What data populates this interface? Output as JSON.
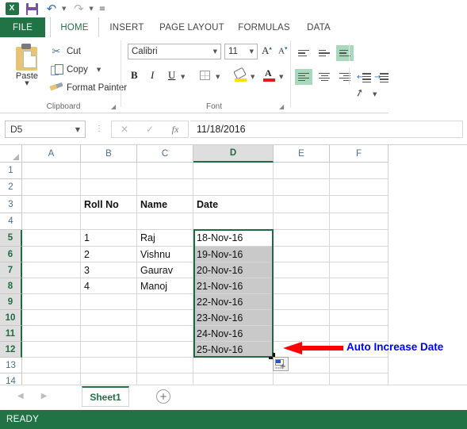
{
  "quick_access": {
    "app_icon": "excel-logo-icon",
    "items": [
      {
        "name": "save",
        "icon": "save-icon"
      },
      {
        "name": "undo",
        "icon": "undo-arrow-icon"
      },
      {
        "name": "redo",
        "icon": "redo-arrow-icon"
      },
      {
        "name": "customize",
        "icon": "customize-qat-icon"
      }
    ]
  },
  "ribbon": {
    "tabs": [
      {
        "label": "FILE",
        "active": false
      },
      {
        "label": "HOME",
        "active": true
      },
      {
        "label": "INSERT",
        "active": false
      },
      {
        "label": "PAGE LAYOUT",
        "active": false
      },
      {
        "label": "FORMULAS",
        "active": false
      },
      {
        "label": "DATA",
        "active": false
      }
    ],
    "clipboard": {
      "group_label": "Clipboard",
      "paste_label": "Paste",
      "cut_label": "Cut",
      "copy_label": "Copy",
      "format_painter_label": "Format Painter"
    },
    "font": {
      "group_label": "Font",
      "font_name": "Calibri",
      "font_size": "11",
      "bold_label": "B",
      "italic_label": "I",
      "underline_label": "U",
      "grow_font_label": "A",
      "shrink_font_label": "A",
      "fill_color": "#ffe000",
      "font_color": "#e01b1b"
    },
    "alignment": {
      "top_align": "top-align-icon",
      "middle_align": "middle-align-icon",
      "bottom_align": "bottom-align-icon",
      "orientation": "orientation-icon",
      "align_left": "align-left-icon",
      "align_center": "align-center-icon",
      "align_right": "align-right-icon",
      "decrease_indent": "decrease-indent-icon",
      "increase_indent": "increase-indent-icon"
    }
  },
  "formula_bar": {
    "name_box_value": "D5",
    "cancel_icon": "cancel-icon",
    "enter_icon": "enter-checkmark-icon",
    "function_icon": "fx",
    "formula_value": "11/18/2016"
  },
  "grid": {
    "columns": [
      {
        "label": "A",
        "selected": false
      },
      {
        "label": "B",
        "selected": false
      },
      {
        "label": "C",
        "selected": false
      },
      {
        "label": "D",
        "selected": true
      },
      {
        "label": "E",
        "selected": false
      },
      {
        "label": "F",
        "selected": false
      }
    ],
    "rows": [
      {
        "label": "1",
        "selected": false
      },
      {
        "label": "2",
        "selected": false
      },
      {
        "label": "3",
        "selected": false
      },
      {
        "label": "4",
        "selected": false
      },
      {
        "label": "5",
        "selected": true
      },
      {
        "label": "6",
        "selected": true
      },
      {
        "label": "7",
        "selected": true
      },
      {
        "label": "8",
        "selected": true
      },
      {
        "label": "9",
        "selected": true
      },
      {
        "label": "10",
        "selected": true
      },
      {
        "label": "11",
        "selected": true
      },
      {
        "label": "12",
        "selected": true
      },
      {
        "label": "13",
        "selected": false
      },
      {
        "label": "14",
        "selected": false
      }
    ],
    "headers": {
      "b3": "Roll No",
      "c3": "Name",
      "d3": "Date"
    },
    "data_rows": [
      {
        "row": "5",
        "roll_no": "1",
        "name": "Raj",
        "date": "18-Nov-16"
      },
      {
        "row": "6",
        "roll_no": "2",
        "name": "Vishnu",
        "date": "19-Nov-16"
      },
      {
        "row": "7",
        "roll_no": "3",
        "name": "Gaurav",
        "date": "20-Nov-16"
      },
      {
        "row": "8",
        "roll_no": "4",
        "name": "Manoj",
        "date": "21-Nov-16"
      },
      {
        "row": "9",
        "roll_no": "",
        "name": "",
        "date": "22-Nov-16"
      },
      {
        "row": "10",
        "roll_no": "",
        "name": "",
        "date": "23-Nov-16"
      },
      {
        "row": "11",
        "roll_no": "",
        "name": "",
        "date": "24-Nov-16"
      },
      {
        "row": "12",
        "roll_no": "",
        "name": "",
        "date": "25-Nov-16"
      }
    ],
    "active_cell": "D5",
    "selection_range": "D5:D12"
  },
  "annotation": {
    "text": "Auto Increase Date",
    "color": "#0000ff",
    "arrow_color": "#ff0000",
    "arrow_direction": "left"
  },
  "autofill": {
    "icon": "auto-fill-options-icon"
  },
  "sheet_bar": {
    "prev_icon": "prev-sheet-icon",
    "next_icon": "next-sheet-icon",
    "tabs": [
      {
        "label": "Sheet1",
        "active": true
      }
    ],
    "add_sheet_label": "+"
  },
  "status_bar": {
    "text": "READY"
  }
}
